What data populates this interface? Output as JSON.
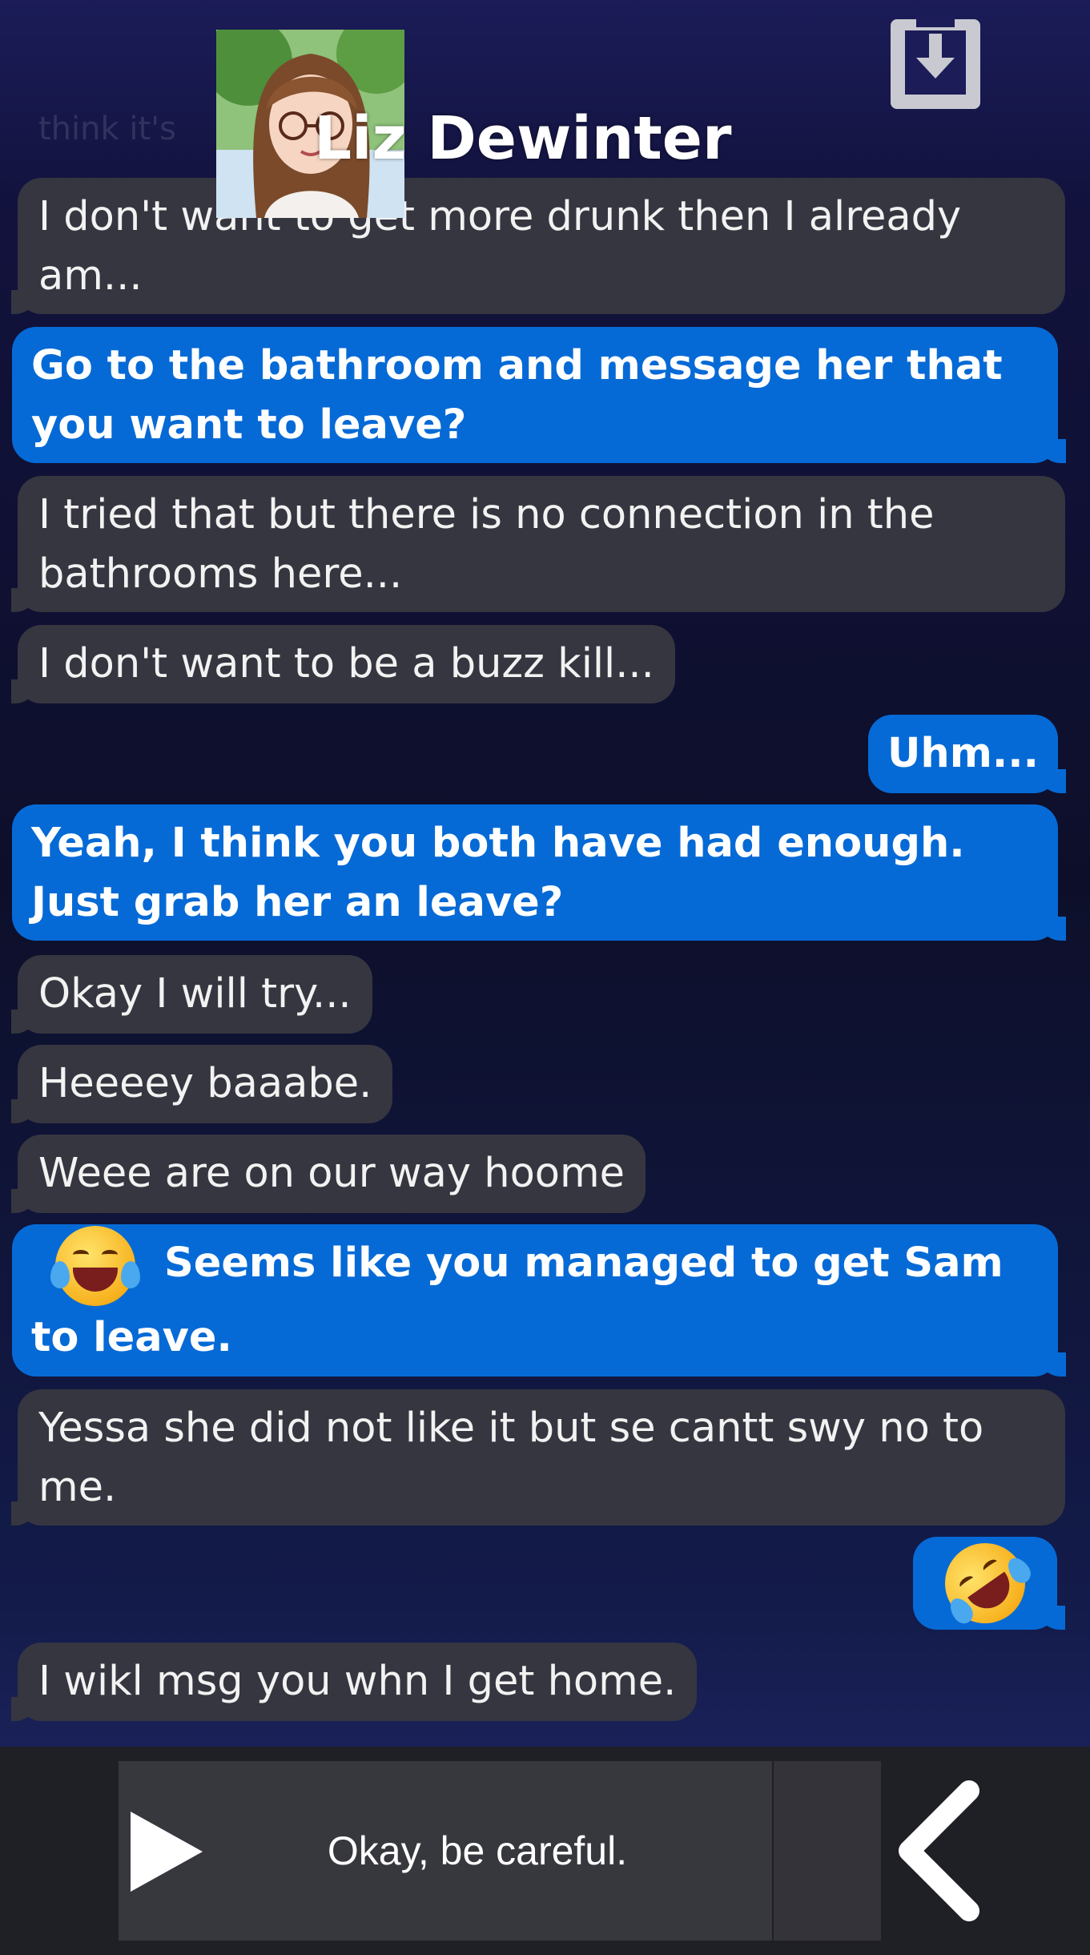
{
  "header": {
    "contact_name": "Liz Dewinter",
    "ghost_text": "think it's"
  },
  "messages": [
    {
      "from": "contact",
      "text": "I don't want to get more drunk then I already am..."
    },
    {
      "from": "me",
      "text": "Go to the bathroom and message her that you want to leave?"
    },
    {
      "from": "contact",
      "text": "I tried that but there is no connection in the bathrooms here..."
    },
    {
      "from": "contact",
      "text": "I don't want to be a buzz kill..."
    },
    {
      "from": "me",
      "text": "Uhm..."
    },
    {
      "from": "me",
      "text": "Yeah, I think you both have had enough. Just grab her an leave?"
    },
    {
      "from": "contact",
      "text": "Okay I will try..."
    },
    {
      "from": "contact",
      "text": "Heeeey baaabe."
    },
    {
      "from": "contact",
      "text": "Weee are on our way hoome"
    },
    {
      "from": "me",
      "emoji": "face-with-tears-of-joy-icon",
      "text": "Seems like you managed to get Sam to leave."
    },
    {
      "from": "contact",
      "text": "Yessa she did not like it but se cantt swy no to me."
    },
    {
      "from": "me",
      "emoji": "rolling-on-floor-laughing-icon",
      "text": ""
    },
    {
      "from": "contact",
      "text": "I wikl msg you whn I get home."
    }
  ],
  "reply_bar": {
    "option_text": "Okay, be careful.",
    "play_icon": "play-icon",
    "back_icon": "chevron-left-icon"
  },
  "colors": {
    "sent_bubble": "#066ad6",
    "received_bubble": "#363640",
    "background_top": "#1b1c58",
    "background_mid": "#0d0f2a",
    "bottom_bar": "#1f1f26"
  }
}
